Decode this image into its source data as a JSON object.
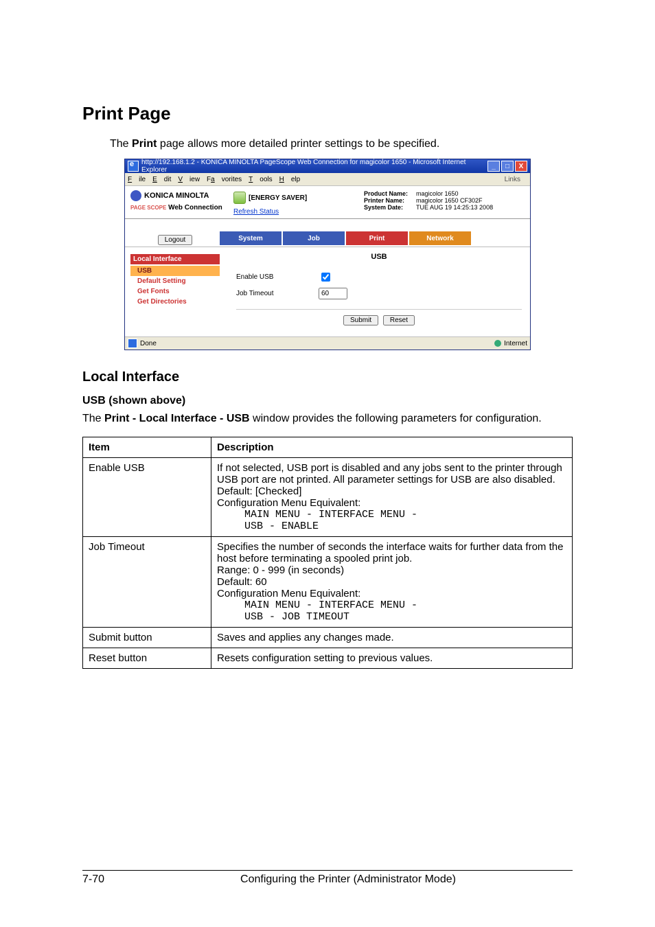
{
  "headings": {
    "print_page": "Print Page",
    "local_interface": "Local Interface",
    "usb_shown": "USB (shown above)"
  },
  "intro_pre": "The ",
  "intro_bold": "Print",
  "intro_post": " page allows more detailed printer settings to be specified.",
  "screenshot": {
    "ie_title": "http://192.168.1.2 - KONICA MINOLTA PageScope Web Connection for magicolor 1650 - Microsoft Internet Explorer",
    "menu": {
      "file": "File",
      "edit": "Edit",
      "view": "View",
      "favorites": "Favorites",
      "tools": "Tools",
      "help": "Help",
      "links": "Links"
    },
    "win": {
      "min": "_",
      "max": "□",
      "close": "X"
    },
    "brand": {
      "km": "KONICA MINOLTA",
      "ps_prefix": "PAGE\nSCOPE",
      "wc": "Web Connection"
    },
    "energy": "[ENERGY SAVER]",
    "refresh": "Refresh Status",
    "info": {
      "product_label": "Product Name:",
      "product_value": "magicolor 1650",
      "printer_label": "Printer Name:",
      "printer_value": "magicolor 1650 CF302F",
      "date_label": "System Date:",
      "date_value": "TUE AUG 19 14:25:13 2008"
    },
    "logout": "Logout",
    "tabs": {
      "system": "System",
      "job": "Job",
      "print": "Print",
      "network": "Network"
    },
    "sidebar": {
      "group": "Local Interface",
      "usb": "USB",
      "default_setting": "Default Setting",
      "get_fonts": "Get Fonts",
      "get_directories": "Get Directories"
    },
    "main": {
      "title": "USB",
      "enable_usb_label": "Enable USB",
      "enable_usb_checked": true,
      "job_timeout_label": "Job Timeout",
      "job_timeout_value": "60",
      "submit": "Submit",
      "reset": "Reset"
    },
    "status": {
      "done": "Done",
      "internet": "Internet"
    }
  },
  "para_pre": "The ",
  "para_bold": "Print - Local Interface - USB",
  "para_post": " window provides the following parameters for configuration.",
  "table": {
    "head_item": "Item",
    "head_desc": "Description",
    "rows": [
      {
        "item": "Enable USB",
        "lines": [
          "If not selected, USB port is disabled and any jobs sent to the printer through USB port are not printed. All parameter settings for USB are also disabled.",
          "Default: [Checked]",
          "Configuration Menu Equivalent:"
        ],
        "mono": "MAIN MENU - INTERFACE MENU -\nUSB - ENABLE"
      },
      {
        "item": "Job Timeout",
        "lines": [
          "Specifies the number of seconds the interface waits for further data from the host before terminating a spooled print job.",
          "Range: 0 - 999 (in seconds)",
          "Default: 60",
          "Configuration Menu Equivalent:"
        ],
        "mono": "MAIN MENU - INTERFACE MENU -\nUSB - JOB TIMEOUT"
      },
      {
        "item": "Submit button",
        "lines": [
          "Saves and applies any changes made."
        ],
        "mono": ""
      },
      {
        "item": "Reset button",
        "lines": [
          "Resets configuration setting to previous values."
        ],
        "mono": ""
      }
    ]
  },
  "footer": {
    "page": "7-70",
    "title": "Configuring the Printer (Administrator Mode)"
  }
}
